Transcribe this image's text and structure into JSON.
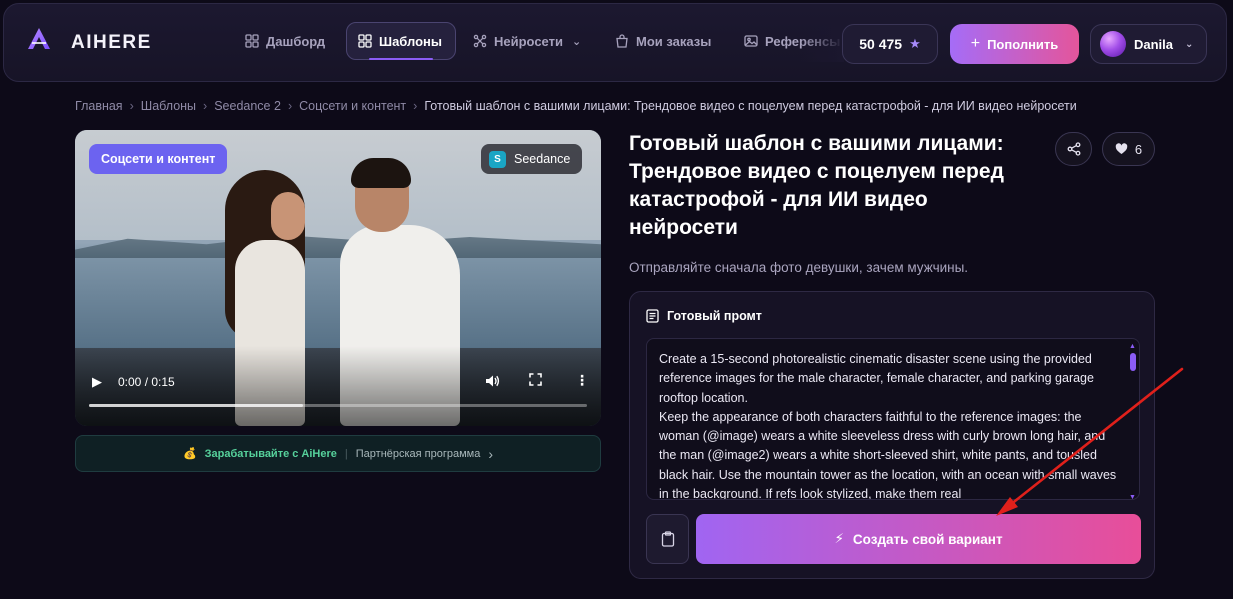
{
  "brand": {
    "name": "AIHERE"
  },
  "nav": {
    "items": [
      {
        "label": "Дашборд",
        "icon": "grid-icon"
      },
      {
        "label": "Шаблоны",
        "icon": "grid-icon",
        "active": true
      },
      {
        "label": "Нейросети",
        "icon": "network-icon",
        "chevron": "⌄"
      },
      {
        "label": "Мои заказы",
        "icon": "bag-icon"
      },
      {
        "label": "Референсы",
        "icon": "image-icon"
      }
    ]
  },
  "balance": {
    "value": "50 475",
    "star": "★"
  },
  "topup": {
    "plus": "+",
    "label": "Пополнить"
  },
  "user": {
    "name": "Danila",
    "chevron": "⌄"
  },
  "breadcrumb": {
    "items": [
      "Главная",
      "Шаблоны",
      "Seedance 2",
      "Соцсети и контент"
    ],
    "separator": "›",
    "current": "Готовый шаблон с вашими лицами: Трендовое видео с поцелуем перед катастрофой - для ИИ видео нейросети"
  },
  "video": {
    "category": "Соцсети и контент",
    "model_letter": "S",
    "model": "Seedance",
    "time": "0:00 / 0:15",
    "buffered_fraction": 0.43,
    "play_glyph": "▶",
    "more_glyph": "⋮"
  },
  "affiliate": {
    "coin": "💰",
    "earn": "Зарабатывайте с AiHere",
    "pipe": "|",
    "program": "Партнёрская программа",
    "chevron": "›"
  },
  "template": {
    "title": "Готовый шаблон с вашими лицами: Трендовое видео с поцелуем перед катастрофой - для ИИ видео нейросети",
    "subtitle": "Отправляйте сначала фото девушки, зачем мужчины.",
    "likes": "6"
  },
  "prompt": {
    "header": "Готовый промт",
    "text": "Create a 15-second photorealistic cinematic disaster scene using the provided reference images for the male character, female character, and parking garage rooftop location.\nKeep the appearance of both characters faithful to the reference images: the woman (@image) wears a white sleeveless dress with curly brown long hair, and the man (@image2) wears a white short-sleeved shirt, white pants, and tousled black hair. Use the mountain tower as the location, with an ocean with small waves in the background. If refs look stylized, make them real"
  },
  "actions": {
    "create_label": "Создать свой вариант",
    "bolt": "⚡"
  },
  "colors": {
    "accent": "#8b5cf6",
    "pink": "#e84e99",
    "arrow": "#e0201b"
  }
}
